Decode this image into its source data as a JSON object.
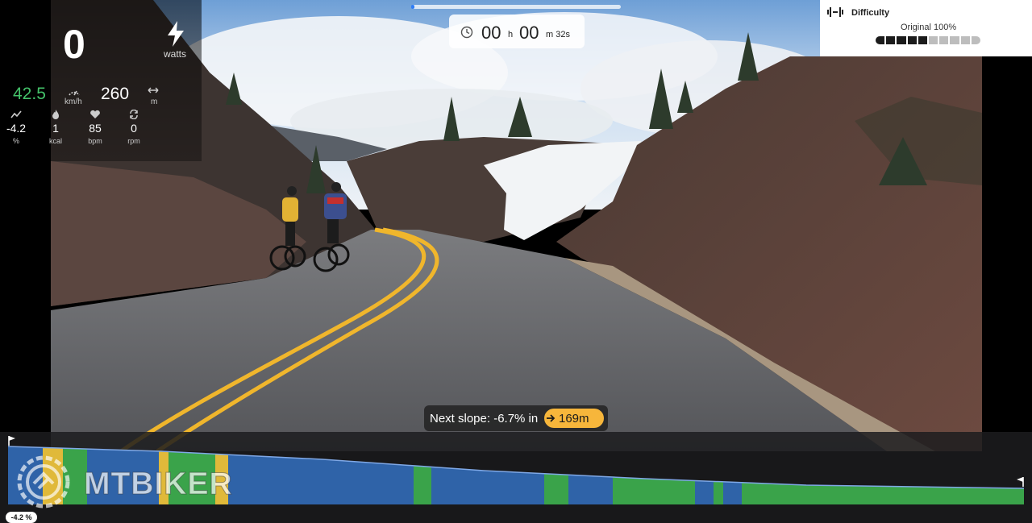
{
  "metrics": {
    "power": {
      "value": "0",
      "unit": "watts",
      "icon": "lightning-bolt-icon"
    },
    "speed": {
      "value": "42.5",
      "unit": "km/h",
      "icon": "speedometer-icon",
      "color": "#44c26a"
    },
    "distance": {
      "value": "260",
      "unit": "m",
      "icon": "horizontal-arrows-icon"
    },
    "grade": {
      "value": "-4.2",
      "unit": "%",
      "icon": "mountain-icon"
    },
    "calories": {
      "value": "1",
      "unit": "kcal",
      "icon": "flame-icon"
    },
    "heart_rate": {
      "value": "85",
      "unit": "bpm",
      "icon": "heart-icon"
    },
    "cadence": {
      "value": "0",
      "unit": "rpm",
      "icon": "refresh-icon"
    }
  },
  "timer": {
    "hours": "00",
    "hours_unit": "h",
    "minutes": "00",
    "minutes_unit": "m",
    "seconds": "32s",
    "progress_fraction": 0.01,
    "progress_color": "#2f7df6"
  },
  "difficulty": {
    "title": "Difficulty",
    "value": "Original 100%",
    "segments_total": 10,
    "segments_filled": 5
  },
  "next_slope": {
    "label": "Next slope: -6.7% in",
    "distance": "169m",
    "pill_color": "#f7b63b"
  },
  "profile": {
    "current_grade": "-4.2 %",
    "colors": {
      "blue": "#2f63a8",
      "green": "#3aa34a",
      "yellow": "#e0b93a"
    }
  },
  "watermark": {
    "text": "MTBIKER"
  }
}
